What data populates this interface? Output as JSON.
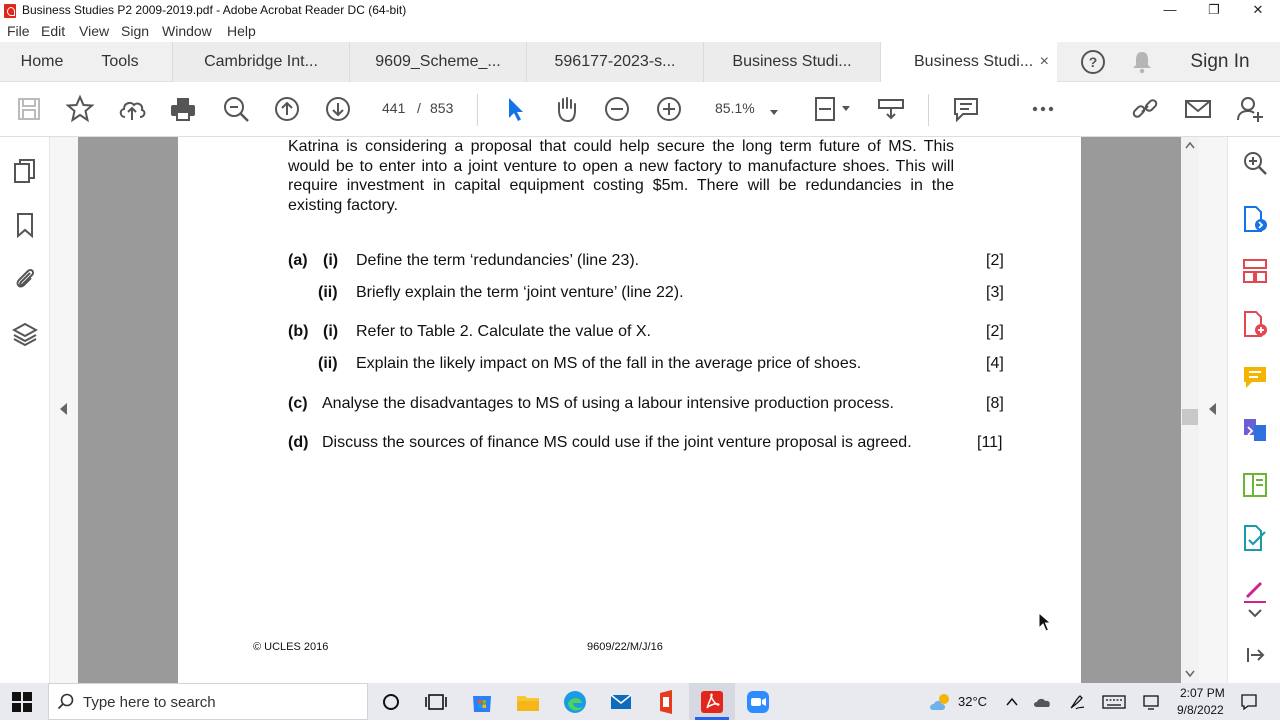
{
  "window": {
    "title": "Business Studies P2 2009-2019.pdf - Adobe Acrobat Reader DC (64-bit)",
    "controls": {
      "minimize": "—",
      "restore": "❐",
      "close": "✕"
    }
  },
  "menu": [
    "File",
    "Edit",
    "View",
    "Sign",
    "Window",
    "Help"
  ],
  "tabs": {
    "home": "Home",
    "tools": "Tools",
    "documents": [
      {
        "label": "Cambridge Int..."
      },
      {
        "label": "9609_Scheme_..."
      },
      {
        "label": "596177-2023-s..."
      },
      {
        "label": "Business Studi..."
      },
      {
        "label": "Business Studi...",
        "active": true
      }
    ],
    "close": "×",
    "sign_in": "Sign In"
  },
  "toolbar": {
    "current_page": "441",
    "page_separator": "/",
    "total_pages": "853",
    "zoom": "85.1%"
  },
  "document": {
    "paragraph": "Katrina is considering a proposal that could help secure the long term future of MS. This would be to enter into a joint venture to open a new factory to manufacture shoes. This will require investment in capital equipment costing $5m. There will be redundancies in the existing factory.",
    "questions": [
      {
        "part": "(a)",
        "sub": "(i)",
        "text": "Define the term ‘redundancies’ (line 23).",
        "marks": "[2]"
      },
      {
        "part": "",
        "sub": "(ii)",
        "text": "Briefly explain the term ‘joint venture’ (line 22).",
        "marks": "[3]"
      },
      {
        "part": "(b)",
        "sub": "(i)",
        "text": "Refer to Table 2. Calculate the value of X.",
        "marks": "[2]"
      },
      {
        "part": "",
        "sub": "(ii)",
        "text": "Explain the likely impact on MS of the fall in the average price of shoes.",
        "marks": "[4]"
      },
      {
        "part": "(c)",
        "sub": "",
        "text": "Analyse the disadvantages to MS of using a labour intensive production process.",
        "marks": "[8]"
      },
      {
        "part": "(d)",
        "sub": "",
        "text": "Discuss the sources of finance MS could use if the joint venture proposal is agreed.",
        "marks": "[11]"
      }
    ],
    "footer_left": "© UCLES 2016",
    "footer_center": "9609/22/M/J/16"
  },
  "taskbar": {
    "search_placeholder": "Type here to search",
    "temperature": "32°C",
    "time": "2:07 PM",
    "date": "9/8/2022"
  },
  "icons": {
    "accent_blue": "#1473e6",
    "pdf_red": "#e3261b"
  }
}
